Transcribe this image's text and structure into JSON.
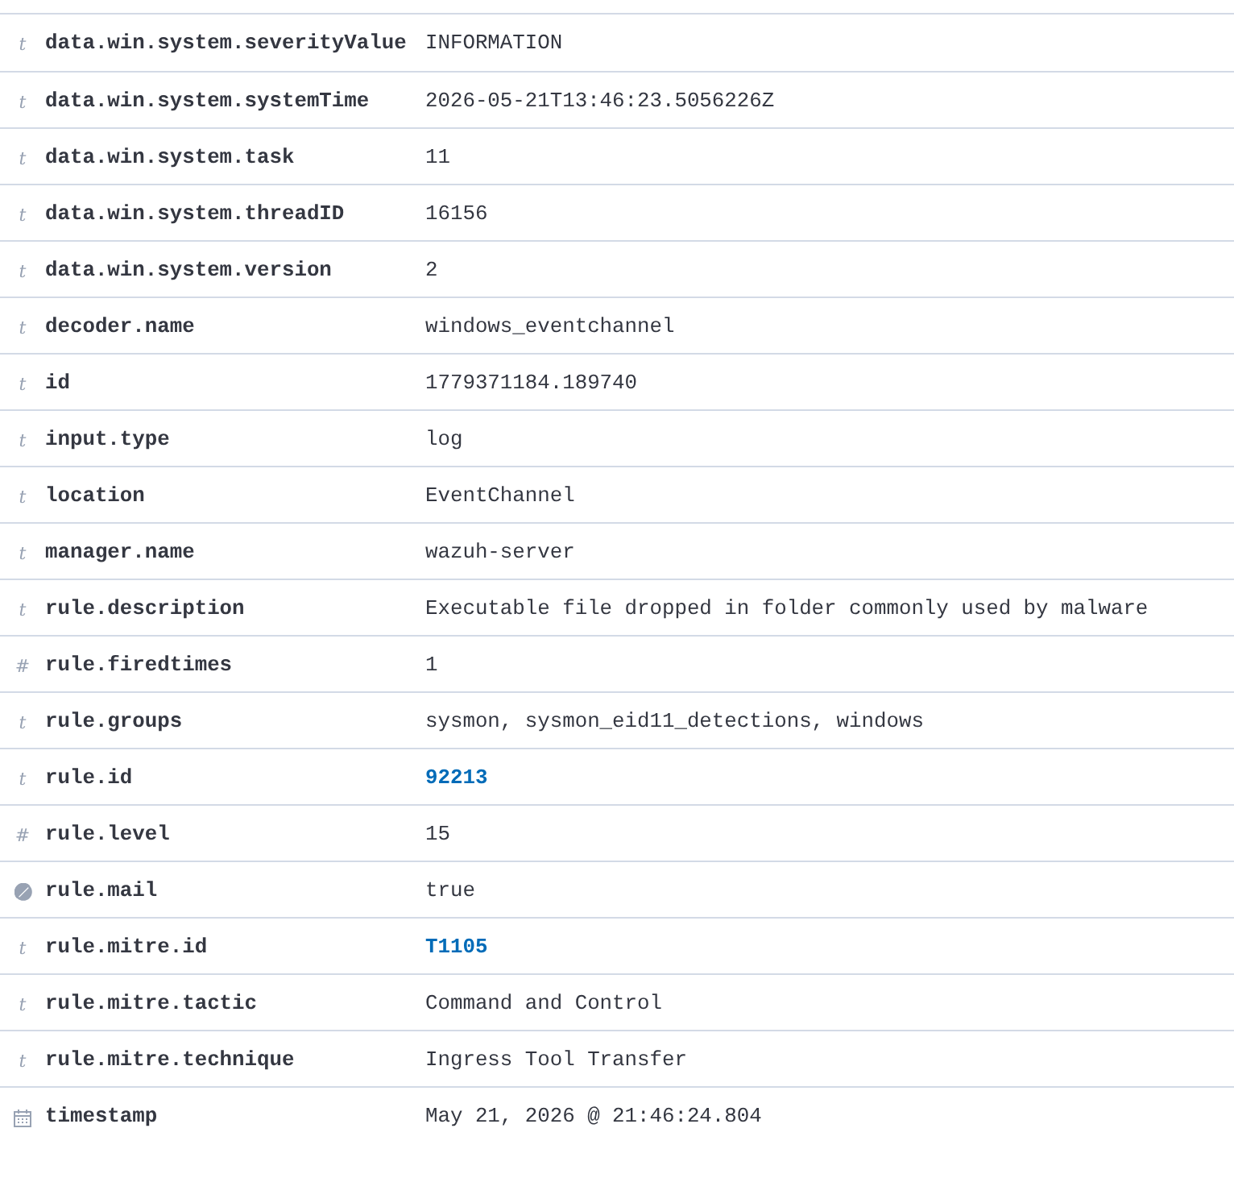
{
  "fields": [
    {
      "kind": "string",
      "glyph": "t",
      "name": "data.win.system.severityValue",
      "value": "INFORMATION",
      "link": false
    },
    {
      "kind": "string",
      "glyph": "t",
      "name": "data.win.system.systemTime",
      "value": "2026-05-21T13:46:23.5056226Z",
      "link": false
    },
    {
      "kind": "string",
      "glyph": "t",
      "name": "data.win.system.task",
      "value": "11",
      "link": false
    },
    {
      "kind": "string",
      "glyph": "t",
      "name": "data.win.system.threadID",
      "value": "16156",
      "link": false
    },
    {
      "kind": "string",
      "glyph": "t",
      "name": "data.win.system.version",
      "value": "2",
      "link": false
    },
    {
      "kind": "string",
      "glyph": "t",
      "name": "decoder.name",
      "value": "windows_eventchannel",
      "link": false
    },
    {
      "kind": "string",
      "glyph": "t",
      "name": "id",
      "value": "1779371184.189740",
      "link": false
    },
    {
      "kind": "string",
      "glyph": "t",
      "name": "input.type",
      "value": "log",
      "link": false
    },
    {
      "kind": "string",
      "glyph": "t",
      "name": "location",
      "value": "EventChannel",
      "link": false
    },
    {
      "kind": "string",
      "glyph": "t",
      "name": "manager.name",
      "value": "wazuh-server",
      "link": false
    },
    {
      "kind": "string",
      "glyph": "t",
      "name": "rule.description",
      "value": "Executable file dropped in folder commonly used by malware",
      "link": false
    },
    {
      "kind": "number",
      "glyph": "#",
      "name": "rule.firedtimes",
      "value": "1",
      "link": false
    },
    {
      "kind": "string",
      "glyph": "t",
      "name": "rule.groups",
      "value": "sysmon, sysmon_eid11_detections, windows",
      "link": false
    },
    {
      "kind": "string",
      "glyph": "t",
      "name": "rule.id",
      "value": "92213",
      "link": true
    },
    {
      "kind": "number",
      "glyph": "#",
      "name": "rule.level",
      "value": "15",
      "link": false
    },
    {
      "kind": "boolean",
      "name": "rule.mail",
      "value": "true",
      "link": false
    },
    {
      "kind": "string",
      "glyph": "t",
      "name": "rule.mitre.id",
      "value": "T1105",
      "link": true
    },
    {
      "kind": "string",
      "glyph": "t",
      "name": "rule.mitre.tactic",
      "value": "Command and Control",
      "link": false
    },
    {
      "kind": "string",
      "glyph": "t",
      "name": "rule.mitre.technique",
      "value": "Ingress Tool Transfer",
      "link": false
    },
    {
      "kind": "date",
      "name": "timestamp",
      "value": "May 21, 2026 @ 21:46:24.804",
      "link": false
    }
  ]
}
